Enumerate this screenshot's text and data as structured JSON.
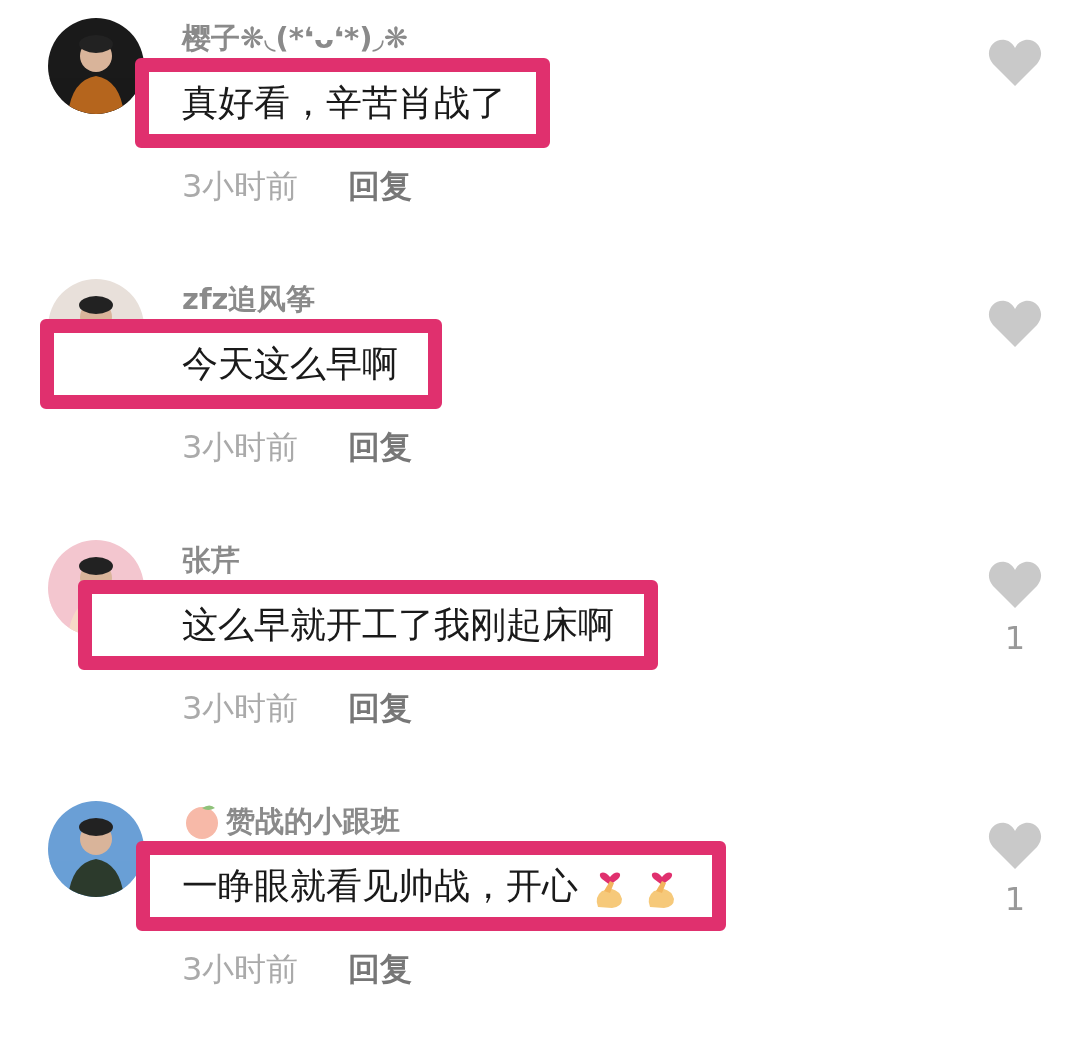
{
  "comments": [
    {
      "username": "樱子❋◟(*❛ᴗ❛*)◞❋",
      "text": "真好看，辛苦肖战了",
      "time": "3小时前",
      "reply": "回复",
      "highlighted": true
    },
    {
      "username": "zfz追风筝",
      "text": "今天这么早啊",
      "time": "3小时前",
      "reply": "回复",
      "highlighted": true
    },
    {
      "username": "张芹",
      "text": "这么早就开工了我刚起床啊",
      "time": "3小时前",
      "reply": "回复",
      "likes": "1",
      "highlighted": true
    },
    {
      "username": "赞战的小跟班",
      "badge": {
        "kind": "peach"
      },
      "text": "一睁眼就看见帅战，开心",
      "stickers": [
        {
          "kind": "finger-heart"
        },
        {
          "kind": "finger-heart"
        }
      ],
      "time": "3小时前",
      "reply": "回复",
      "likes": "1",
      "highlighted": true
    }
  ]
}
